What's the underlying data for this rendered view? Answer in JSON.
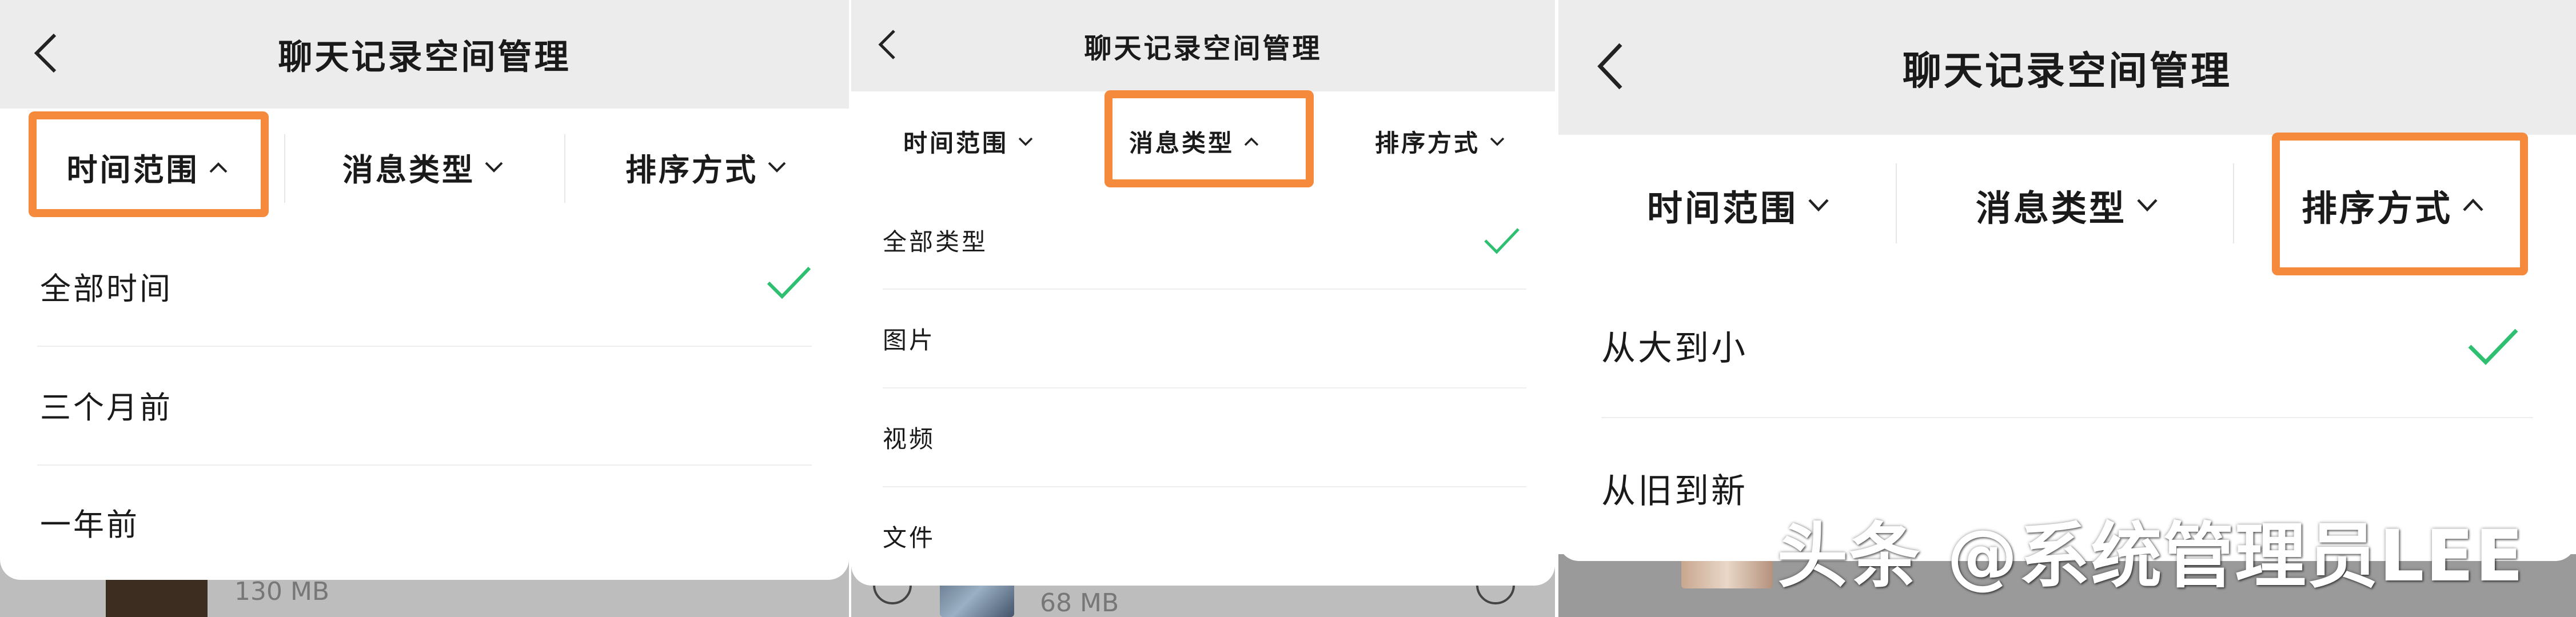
{
  "accent": "#f5893c",
  "check_color": "#2fbf71",
  "panels": [
    {
      "title": "聊天记录空间管理",
      "filters": [
        {
          "label": "时间范围",
          "caret": "chevron-up-icon",
          "highlighted": true
        },
        {
          "label": "消息类型",
          "caret": "chevron-down-icon",
          "highlighted": false
        },
        {
          "label": "排序方式",
          "caret": "chevron-down-icon",
          "highlighted": false
        }
      ],
      "options": [
        {
          "label": "全部时间",
          "selected": true
        },
        {
          "label": "三个月前",
          "selected": false
        },
        {
          "label": "一年前",
          "selected": false
        }
      ],
      "bottom_item": {
        "size": "130 MB"
      }
    },
    {
      "title": "聊天记录空间管理",
      "filters": [
        {
          "label": "时间范围",
          "caret": "chevron-down-icon",
          "highlighted": false
        },
        {
          "label": "消息类型",
          "caret": "chevron-up-icon",
          "highlighted": true
        },
        {
          "label": "排序方式",
          "caret": "chevron-down-icon",
          "highlighted": false
        }
      ],
      "options": [
        {
          "label": "全部类型",
          "selected": true
        },
        {
          "label": "图片",
          "selected": false
        },
        {
          "label": "视频",
          "selected": false
        },
        {
          "label": "文件",
          "selected": false
        }
      ],
      "bottom_item": {
        "size": "68 MB"
      }
    },
    {
      "title": "聊天记录空间管理",
      "filters": [
        {
          "label": "时间范围",
          "caret": "chevron-down-icon",
          "highlighted": false
        },
        {
          "label": "消息类型",
          "caret": "chevron-down-icon",
          "highlighted": false
        },
        {
          "label": "排序方式",
          "caret": "chevron-up-icon",
          "highlighted": true
        }
      ],
      "options": [
        {
          "label": "从大到小",
          "selected": true
        },
        {
          "label": "从旧到新",
          "selected": false
        }
      ],
      "bottom_item": {
        "size": ""
      }
    }
  ],
  "watermark": "头条 @系统管理员LEE"
}
